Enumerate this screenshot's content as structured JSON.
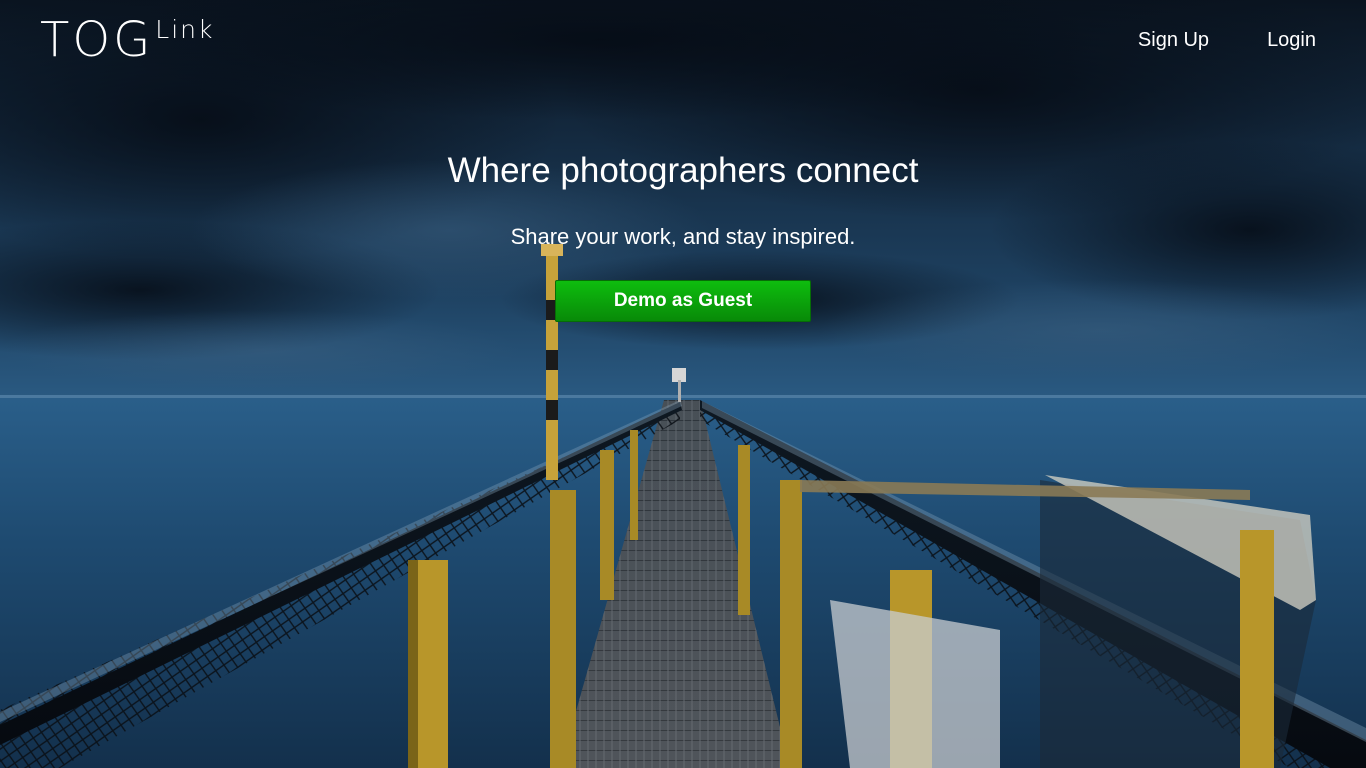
{
  "brand": {
    "main": "TOG",
    "sub": "Link"
  },
  "nav": {
    "signup_label": "Sign Up",
    "login_label": "Login"
  },
  "hero": {
    "headline": "Where photographers connect",
    "tagline": "Share your work, and stay inspired.",
    "demo_button_label": "Demo as Guest",
    "background_image": "night-pier-over-sea"
  },
  "colors": {
    "button_green": "#0aa80a",
    "text": "#ffffff",
    "sky": "#0f2438",
    "sea": "#1f4e74"
  }
}
